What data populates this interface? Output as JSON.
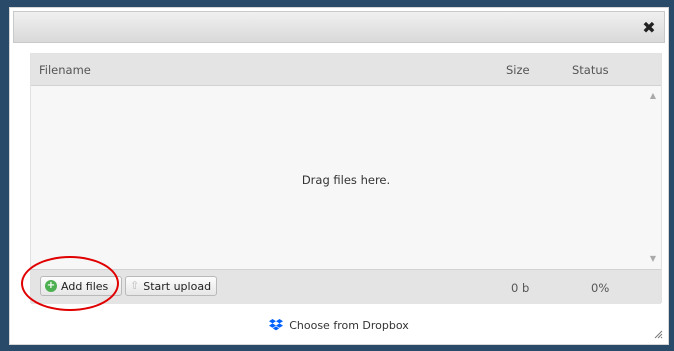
{
  "dialog": {
    "close_glyph": "✖"
  },
  "uploader": {
    "columns": {
      "filename": "Filename",
      "size": "Size",
      "status": "Status"
    },
    "drop_text": "Drag files here.",
    "buttons": {
      "add_files": "Add files",
      "start_upload": "Start upload"
    },
    "total_size": "0 b",
    "total_percent": "0%"
  },
  "dropbox": {
    "label": "Choose from Dropbox"
  },
  "colors": {
    "annotation": "#e00000",
    "add_icon": "#4caf50",
    "dropbox_icon": "#0061fe"
  },
  "icons": [
    "close-icon",
    "add-icon",
    "upload-icon",
    "dropbox-icon",
    "scroll-up-arrow-icon",
    "scroll-down-arrow-icon",
    "resize-handle-icon"
  ]
}
